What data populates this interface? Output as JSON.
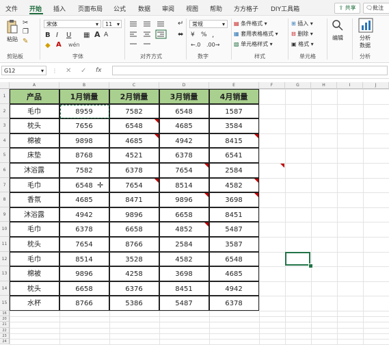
{
  "menu": {
    "tabs": [
      "文件",
      "开始",
      "插入",
      "页面布局",
      "公式",
      "数据",
      "审阅",
      "视图",
      "帮助",
      "方方格子",
      "DIY工具箱"
    ],
    "active_tab": "开始",
    "share_label": "共享",
    "comment_label": "批注"
  },
  "ribbon": {
    "clipboard": {
      "paste_label": "粘贴",
      "group_label": "剪贴板"
    },
    "font": {
      "font_name": "宋体",
      "font_size": "11",
      "bold": "B",
      "italic": "I",
      "underline": "U",
      "wen": "wén",
      "group_label": "字体"
    },
    "alignment": {
      "group_label": "对齐方式"
    },
    "number": {
      "format": "常规",
      "percent": "%",
      "comma": ",",
      "group_label": "数字"
    },
    "styles": {
      "cond_format": "条件格式",
      "table_format": "套用表格格式",
      "cell_styles": "单元格样式",
      "group_label": "样式"
    },
    "cells": {
      "insert": "插入",
      "delete": "删除",
      "format": "格式",
      "group_label": "单元格"
    },
    "editing": {
      "label": "编辑"
    },
    "analysis": {
      "label_1": "分析",
      "label_2": "数据",
      "group_label": "分析"
    }
  },
  "formula_bar": {
    "name_box": "G12",
    "fx": "fx",
    "formula": ""
  },
  "columns": [
    "A",
    "B",
    "C",
    "D",
    "E",
    "F",
    "G",
    "H",
    "I",
    "J"
  ],
  "rows": [
    "1",
    "2",
    "3",
    "4",
    "5",
    "6",
    "7",
    "8",
    "9",
    "10",
    "11",
    "12",
    "13",
    "14",
    "15",
    "16",
    "20",
    "21",
    "22",
    "23",
    "24"
  ],
  "table": {
    "headers": [
      "产品",
      "1月销量",
      "2月销量",
      "3月销量",
      "4月销量"
    ],
    "rows": [
      [
        "毛巾",
        "8959",
        "7582",
        "6548",
        "1587"
      ],
      [
        "枕头",
        "7656",
        "6548",
        "4685",
        "3584"
      ],
      [
        "棉被",
        "9898",
        "4685",
        "4942",
        "8415"
      ],
      [
        "床垫",
        "8768",
        "4521",
        "6378",
        "6541"
      ],
      [
        "沐浴露",
        "7582",
        "6378",
        "7654",
        "2584"
      ],
      [
        "毛巾",
        "6548",
        "7654",
        "8514",
        "4582"
      ],
      [
        "香氛",
        "4685",
        "8471",
        "9896",
        "3698"
      ],
      [
        "沐浴露",
        "4942",
        "9896",
        "6658",
        "8451"
      ],
      [
        "毛巾",
        "6378",
        "6658",
        "4852",
        "5487"
      ],
      [
        "枕头",
        "7654",
        "8766",
        "2584",
        "3587"
      ],
      [
        "毛巾",
        "8514",
        "3528",
        "4582",
        "6548"
      ],
      [
        "棉被",
        "9896",
        "4258",
        "3698",
        "4685"
      ],
      [
        "枕头",
        "6658",
        "6376",
        "8451",
        "4942"
      ],
      [
        "水杯",
        "8766",
        "5386",
        "5487",
        "6378"
      ]
    ]
  },
  "colors": {
    "header_fill": "#a9d08e",
    "accent": "#1d6b3b",
    "selection": "#217346",
    "comment_marker": "#c00000"
  }
}
